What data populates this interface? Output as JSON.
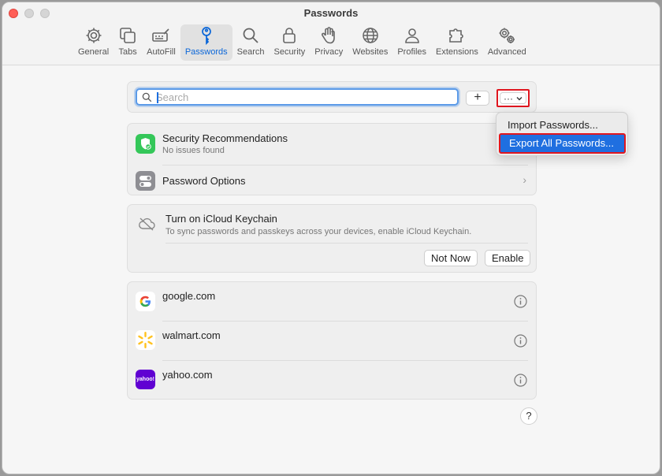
{
  "window": {
    "title": "Passwords"
  },
  "toolbar": {
    "tabs": [
      {
        "label": "General",
        "icon": "gear-icon"
      },
      {
        "label": "Tabs",
        "icon": "tabs-icon"
      },
      {
        "label": "AutoFill",
        "icon": "autofill-icon"
      },
      {
        "label": "Passwords",
        "icon": "key-icon",
        "active": true
      },
      {
        "label": "Search",
        "icon": "search-icon"
      },
      {
        "label": "Security",
        "icon": "lock-icon"
      },
      {
        "label": "Privacy",
        "icon": "hand-icon"
      },
      {
        "label": "Websites",
        "icon": "globe-icon"
      },
      {
        "label": "Profiles",
        "icon": "person-icon"
      },
      {
        "label": "Extensions",
        "icon": "puzzle-icon"
      },
      {
        "label": "Advanced",
        "icon": "gears-icon"
      }
    ]
  },
  "search": {
    "placeholder": "Search",
    "value": ""
  },
  "buttons": {
    "add": "+",
    "more": "···"
  },
  "security": {
    "title": "Security Recommendations",
    "subtitle": "No issues found"
  },
  "options": {
    "title": "Password Options"
  },
  "icloud": {
    "title": "Turn on iCloud Keychain",
    "subtitle": "To sync passwords and passkeys across your devices, enable iCloud Keychain.",
    "not_now": "Not Now",
    "enable": "Enable"
  },
  "sites": [
    {
      "name": "google.com"
    },
    {
      "name": "walmart.com"
    },
    {
      "name": "yahoo.com",
      "logo_text": "yahoo!"
    }
  ],
  "menu": {
    "import": "Import Passwords...",
    "export": "Export All Passwords..."
  },
  "help": "?",
  "colors": {
    "accent": "#1f6fe0",
    "highlight_border": "#e0161f",
    "security_green": "#34c759",
    "yahoo_purple": "#6001d2",
    "walmart_yellow": "#ffc220"
  }
}
